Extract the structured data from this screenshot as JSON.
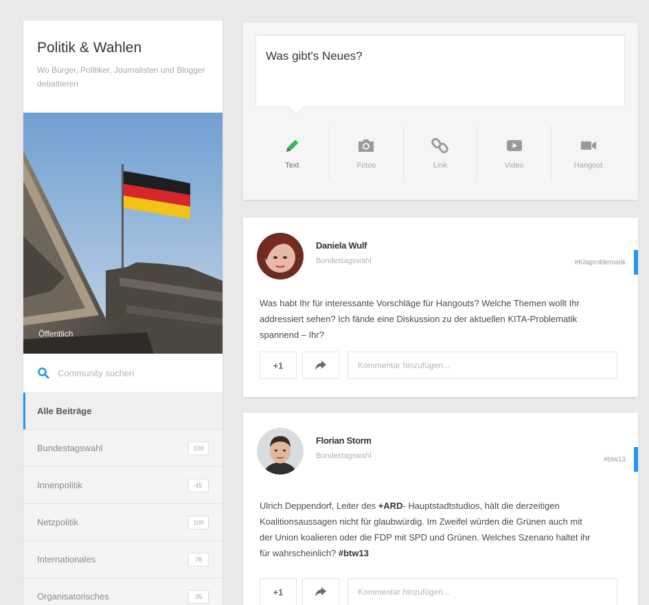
{
  "community": {
    "title": "Politik & Wahlen",
    "description": "Wo Bürger, Politiker, Journalisten und Blogger debattieren",
    "visibility": "Öffentlich",
    "search_placeholder": "Community suchen"
  },
  "nav": [
    {
      "label": "Alle Beiträge",
      "count": ""
    },
    {
      "label": "Bundestagswahl",
      "count": "100"
    },
    {
      "label": "Innenpolitik",
      "count": "45"
    },
    {
      "label": "Netzpolitik",
      "count": "100"
    },
    {
      "label": "Internationales",
      "count": "78"
    },
    {
      "label": "Organisatorisches",
      "count": "35"
    }
  ],
  "composer": {
    "prompt": "Was gibt's Neues?",
    "actions": [
      {
        "label": "Text",
        "icon": "pencil-icon"
      },
      {
        "label": "Fotos",
        "icon": "camera-icon"
      },
      {
        "label": "Link",
        "icon": "link-icon"
      },
      {
        "label": "Video",
        "icon": "play-icon"
      },
      {
        "label": "Hangout",
        "icon": "video-camera-icon"
      }
    ]
  },
  "posts": [
    {
      "author": "Daniela Wulf",
      "category": "Bundestagswahl",
      "hashtag": "#Kitaproblematik",
      "text": "Was habt Ihr für interessante Vorschläge für Hangouts? Welche Themen wollt Ihr addressiert sehen? Ich fände eine Diskussion zu der aktuellen KITA-Problematik spannend – Ihr?",
      "plus_label": "+1",
      "comment_placeholder": "Kommentar hinzufügen..."
    },
    {
      "author": "Florian Storm",
      "category": "Bundestagswahl",
      "hashtag": "#btw13",
      "text_before": "Ulrich Deppendorf, Leiter des ",
      "text_bold": "+ARD",
      "text_after": "- Hauptstadtstudios, hält die derzeitigen Koalitionsaussagen nicht für glaubwürdig. Im Zweifel würden die Grünen auch mit der Union koalieren oder die FDP mit SPD und Grünen. Welches Szenario haltet ihr für wahrscheinlich? ",
      "text_tag": "#btw13",
      "plus_label": "+1",
      "comment_placeholder": "Kommentar hinzufügen..."
    }
  ],
  "colors": {
    "accent": "#2196f3",
    "text_icon": "#3bb55d",
    "icon_gray": "#9a9a9a"
  }
}
